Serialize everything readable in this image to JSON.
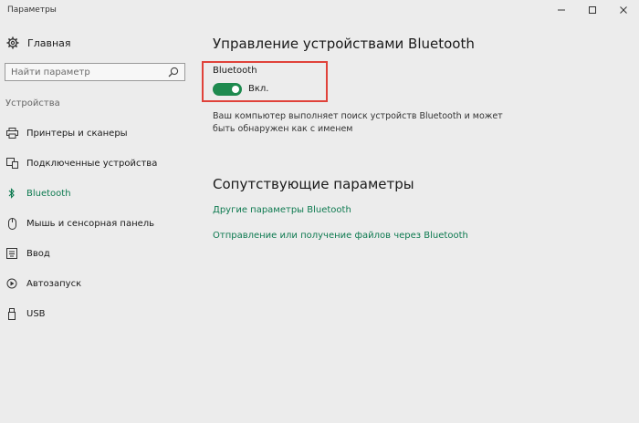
{
  "window": {
    "title": "Параметры"
  },
  "sidebar": {
    "home_label": "Главная",
    "search_placeholder": "Найти параметр",
    "section_label": "Устройства",
    "items": [
      {
        "label": "Принтеры и сканеры",
        "icon": "printer-icon"
      },
      {
        "label": "Подключенные устройства",
        "icon": "devices-icon"
      },
      {
        "label": "Bluetooth",
        "icon": "bluetooth-icon",
        "active": true
      },
      {
        "label": "Мышь и сенсорная панель",
        "icon": "mouse-icon"
      },
      {
        "label": "Ввод",
        "icon": "keyboard-icon"
      },
      {
        "label": "Автозапуск",
        "icon": "autoplay-icon"
      },
      {
        "label": "USB",
        "icon": "usb-icon"
      }
    ]
  },
  "main": {
    "heading": "Управление устройствами Bluetooth",
    "bluetooth_label": "Bluetooth",
    "toggle_state": "Вкл.",
    "description": "Ваш компьютер выполняет поиск устройств Bluetooth и может быть обнаружен как с именем",
    "related_heading": "Сопутствующие параметры",
    "links": [
      "Другие параметры Bluetooth",
      "Отправление или получение файлов через Bluetooth"
    ]
  },
  "colors": {
    "accent": "#0e7a50",
    "toggle_on": "#1e8a4f",
    "highlight_box": "#e0423a",
    "background": "#ececec"
  }
}
